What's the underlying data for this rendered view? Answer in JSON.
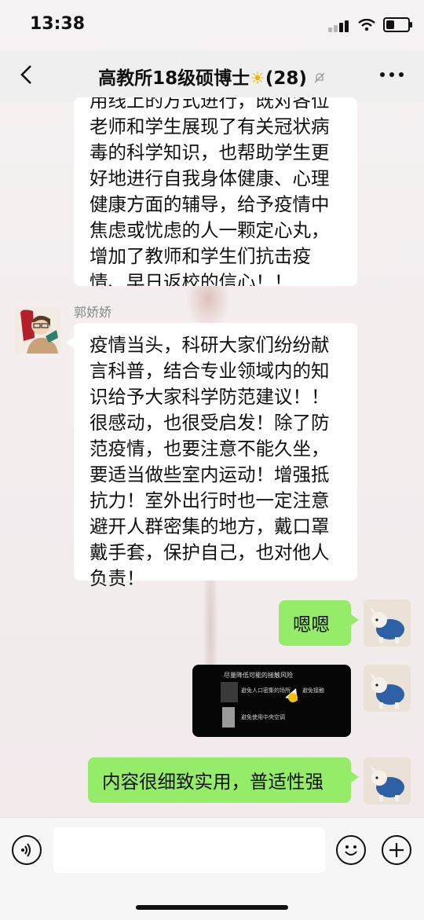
{
  "status_bar": {
    "time": "13:38"
  },
  "nav": {
    "title": "高教所18级硕博士",
    "sun_glyph": "☀",
    "member_count": "(28)",
    "back_icon": "chevron-left-icon",
    "mute_icon": "bell-off-icon",
    "more_icon": "more-icon"
  },
  "messages": {
    "top_lines": [
      "用线上的方式进行，既对各位",
      "老师和学生展现了有关冠状病",
      "毒的科学知识，也帮助学生更",
      "好地进行自我身体健康、心理",
      "健康方面的辅导，给予疫情中",
      "焦虑或忧虑的人一颗定心丸，",
      "增加了教师和学生们抗击疫",
      "情、早日返校的信心！！"
    ],
    "sender_name": "郭娇娇",
    "second_lines": [
      "疫情当头，科研大家们纷纷献",
      "言科普，结合专业领域内的知",
      "识给予大家科学防范建议！！",
      "很感动，也很受启发！除了防",
      "范疫情，也要注意不能久坐，",
      "要适当做些室内运动！增强抵",
      "抗力！室外出行时也一定注意",
      "避开人群密集的地方，戴口罩",
      "戴手套，保护自己，也对他人",
      "负责！"
    ],
    "reply_1": "嗯嗯",
    "image_caption": "尽量降低可能的接触风险",
    "image_text_1": "避免人口密集的场所",
    "image_text_2": "避免接触",
    "image_text_3": "避免使用中央空调",
    "reply_2": "内容很细致实用，普适性强"
  },
  "input": {
    "voice_icon": "voice-icon",
    "emoji_icon": "emoji-icon",
    "plus_icon": "plus-icon"
  },
  "colors": {
    "green_bubble": "#95ec69",
    "nav_bg": "#eeeeee",
    "sun": "#f6b200"
  }
}
